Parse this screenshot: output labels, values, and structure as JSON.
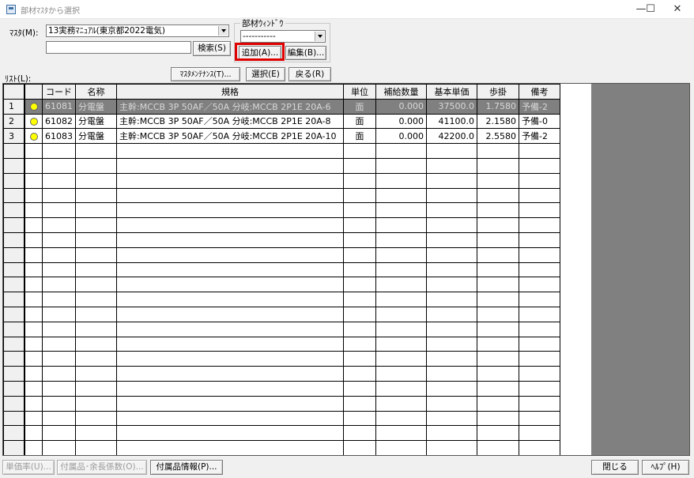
{
  "window": {
    "title": "部材ﾏｽﾀから選択",
    "minimize_glyph": "—",
    "maximize_glyph": "☐",
    "close_glyph": "✕"
  },
  "master": {
    "label": "ﾏｽﾀ(M):",
    "selected": "13実務ﾏﾆｭｱﾙ(東京都2022電気)"
  },
  "search": {
    "value": "",
    "button": "検索(S)"
  },
  "parts_window": {
    "group_label": "部材ｳｨﾝﾄﾞｳ",
    "selected": "-----------",
    "add_button": "追加(A)...",
    "edit_button": "編集(B)..."
  },
  "list": {
    "label": "ﾘｽﾄ(L):",
    "maintenance_button": "ﾏｽﾀﾒﾝﾃﾅﾝｽ(T)...",
    "select_button": "選択(E)",
    "back_button": "戻る(R)"
  },
  "table": {
    "columns": [
      "コード",
      "名称",
      "規格",
      "単位",
      "補給数量",
      "基本単価",
      "歩掛",
      "備考"
    ],
    "rows": [
      {
        "no": "1",
        "code": "61081",
        "name": "分電盤",
        "spec": "主幹:MCCB 3P 50AF／50A 分岐:MCCB 2P1E 20A-6",
        "unit": "面",
        "qty": "0.000",
        "price": "37500.0",
        "rate": "1.7580",
        "note": "予備-2"
      },
      {
        "no": "2",
        "code": "61082",
        "name": "分電盤",
        "spec": "主幹:MCCB 3P 50AF／50A 分岐:MCCB 2P1E 20A-8",
        "unit": "面",
        "qty": "0.000",
        "price": "41100.0",
        "rate": "2.1580",
        "note": "予備-0"
      },
      {
        "no": "3",
        "code": "61083",
        "name": "分電盤",
        "spec": "主幹:MCCB 3P 50AF／50A 分岐:MCCB 2P1E 20A-10",
        "unit": "面",
        "qty": "0.000",
        "price": "42200.0",
        "rate": "2.5580",
        "note": "予備-2"
      }
    ]
  },
  "footer": {
    "unit_price_rate_button": "単価率(U)...",
    "accessory_button": "付属品･余長係数(O)...",
    "accessory_info_button": "付属品情報(P)...",
    "close_button": "閉じる",
    "help_button": "ﾍﾙﾌﾟ(H)"
  },
  "colors": {
    "highlight": "#e00000",
    "selected_row": "#808080",
    "status_dot": "#ffff00"
  }
}
